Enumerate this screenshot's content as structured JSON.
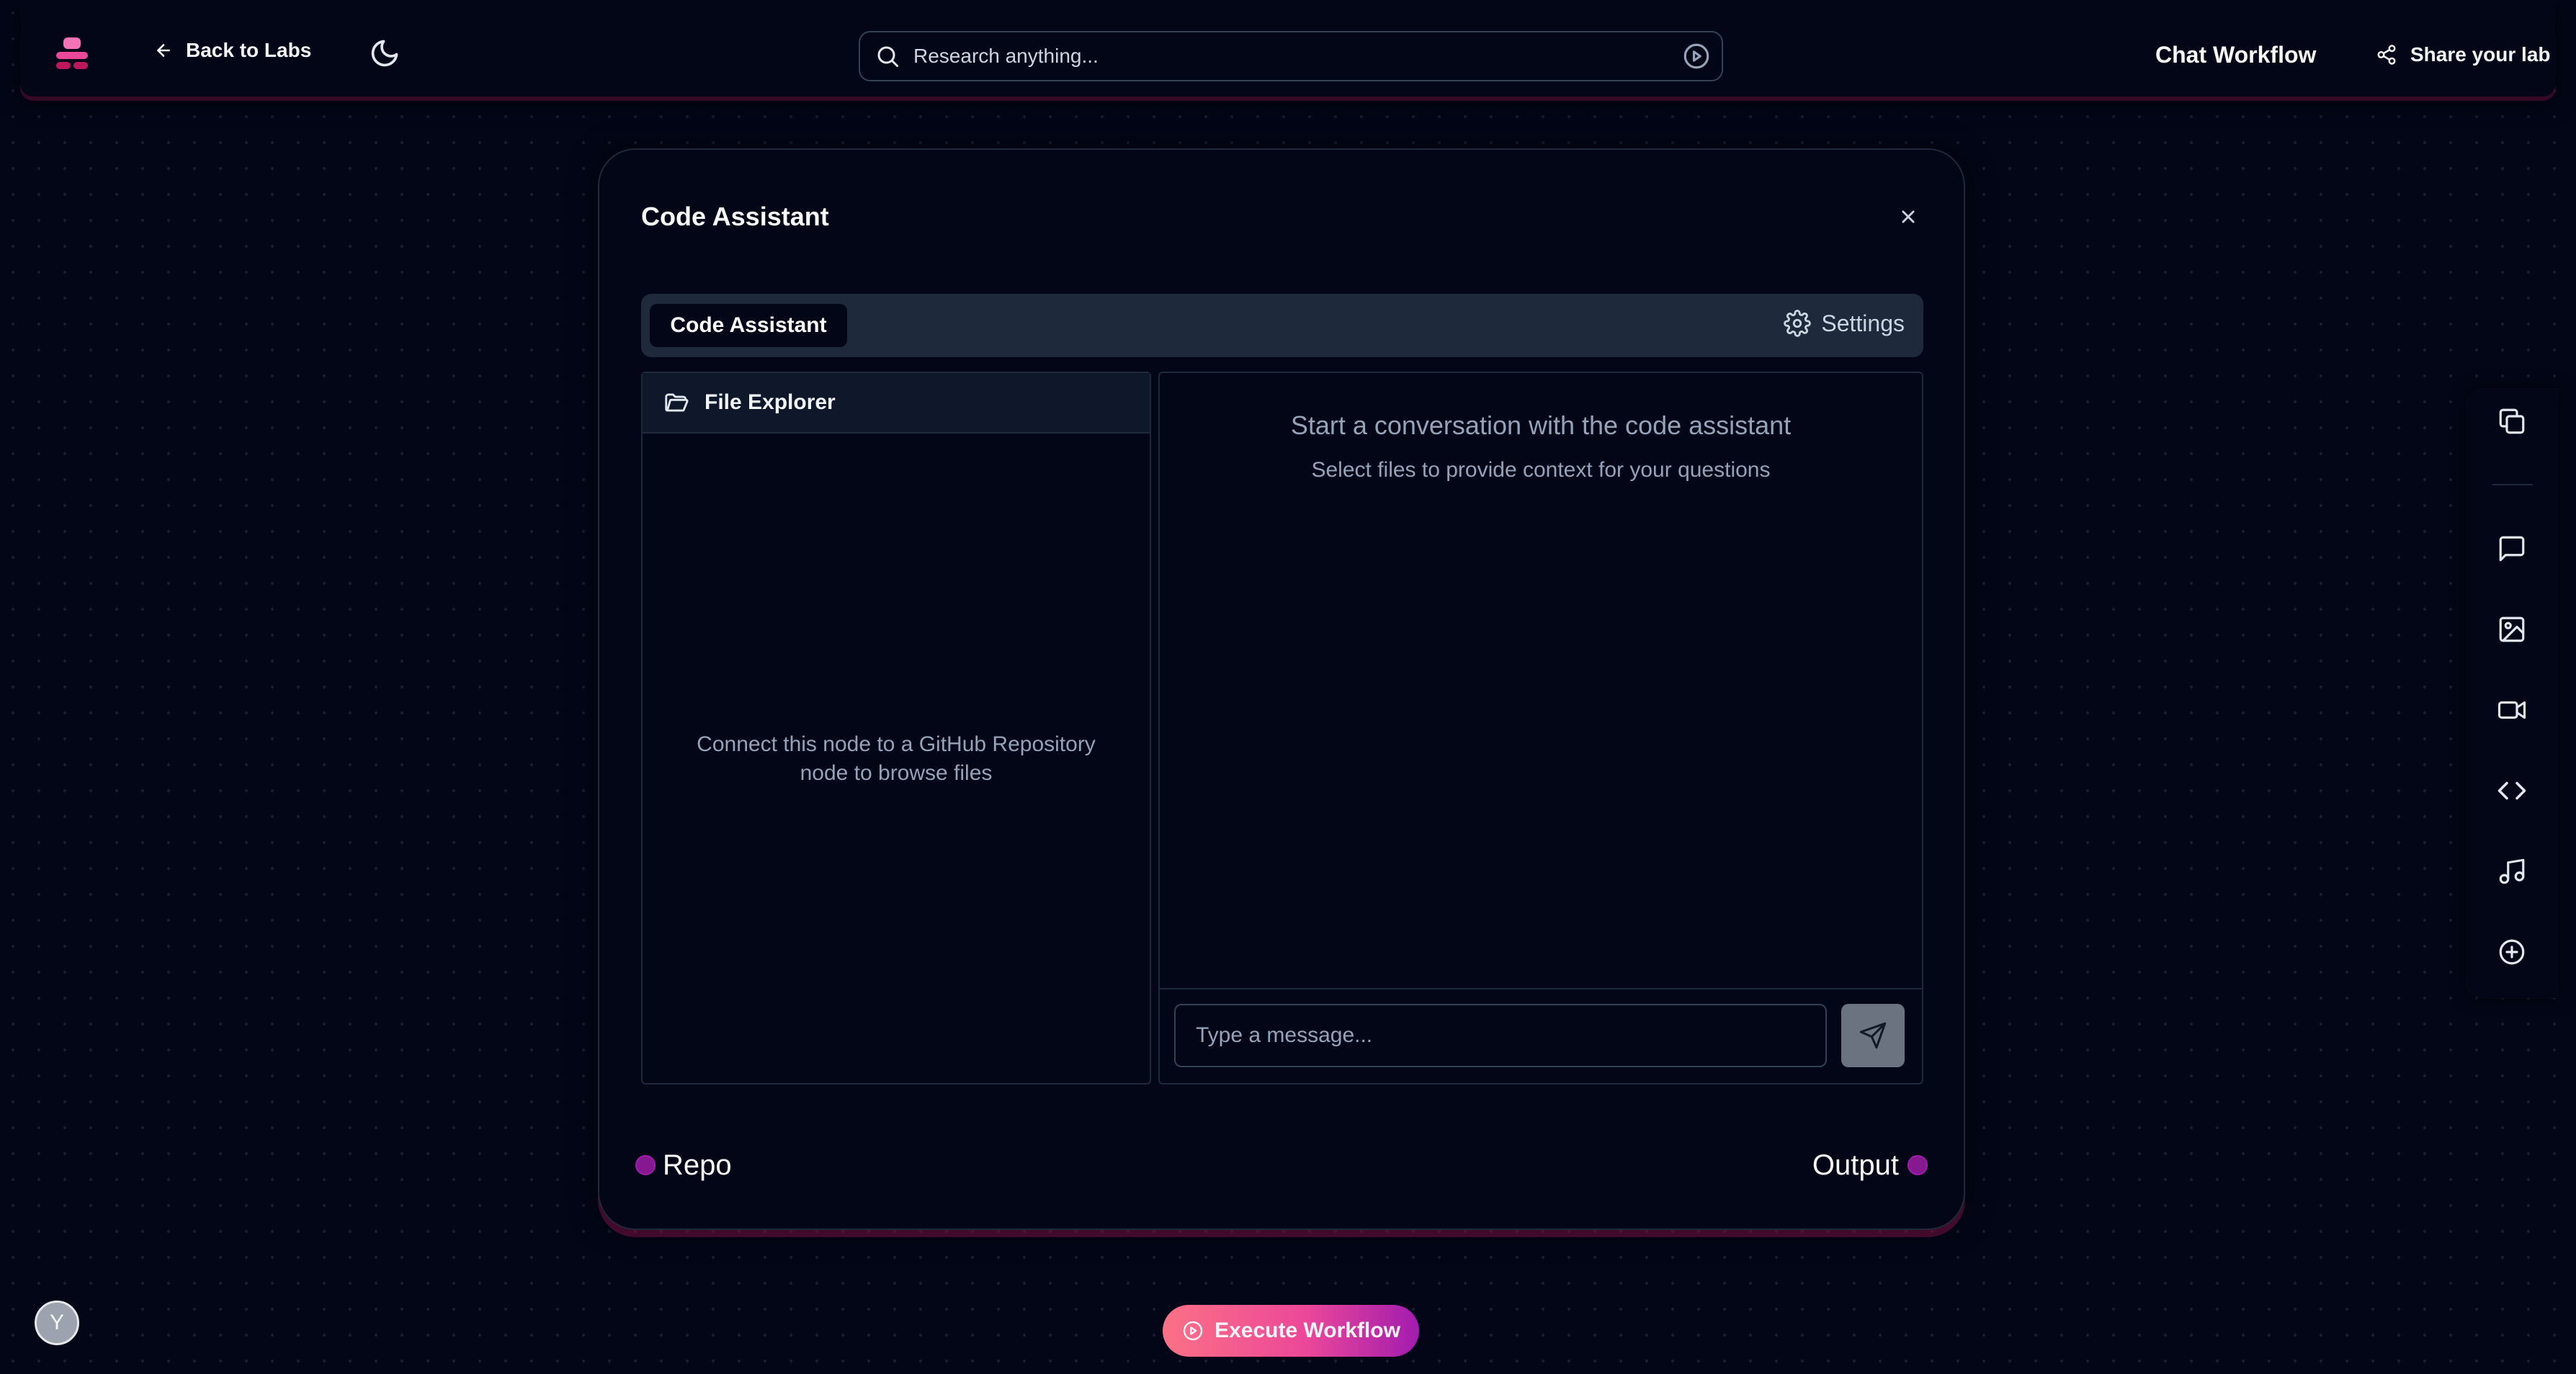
{
  "header": {
    "back_label": "Back to Labs",
    "search_placeholder": "Research anything...",
    "workflow_name": "Chat Workflow",
    "share_label": "Share your lab"
  },
  "node": {
    "title": "Code Assistant",
    "tab_active": "Code Assistant",
    "settings_label": "Settings",
    "explorer": {
      "title": "File Explorer",
      "empty_line1": "Connect this node to a GitHub Repository",
      "empty_line2": "node to browse files"
    },
    "chat": {
      "title": "Start a conversation with the code assistant",
      "subtitle": "Select files to provide context for your questions",
      "input_placeholder": "Type a message..."
    },
    "input_port_label": "Repo",
    "output_port_label": "Output"
  },
  "rail": {
    "icons": [
      "copy-icon",
      "chat-icon",
      "image-icon",
      "video-icon",
      "code-icon",
      "music-icon",
      "add-icon"
    ]
  },
  "footer": {
    "execute_label": "Execute Workflow",
    "avatar_initial": "Y"
  },
  "colors": {
    "background": "#020617",
    "accent_pink": "#ec4899",
    "port_magenta": "#86198f",
    "panel": "#1e293b"
  }
}
